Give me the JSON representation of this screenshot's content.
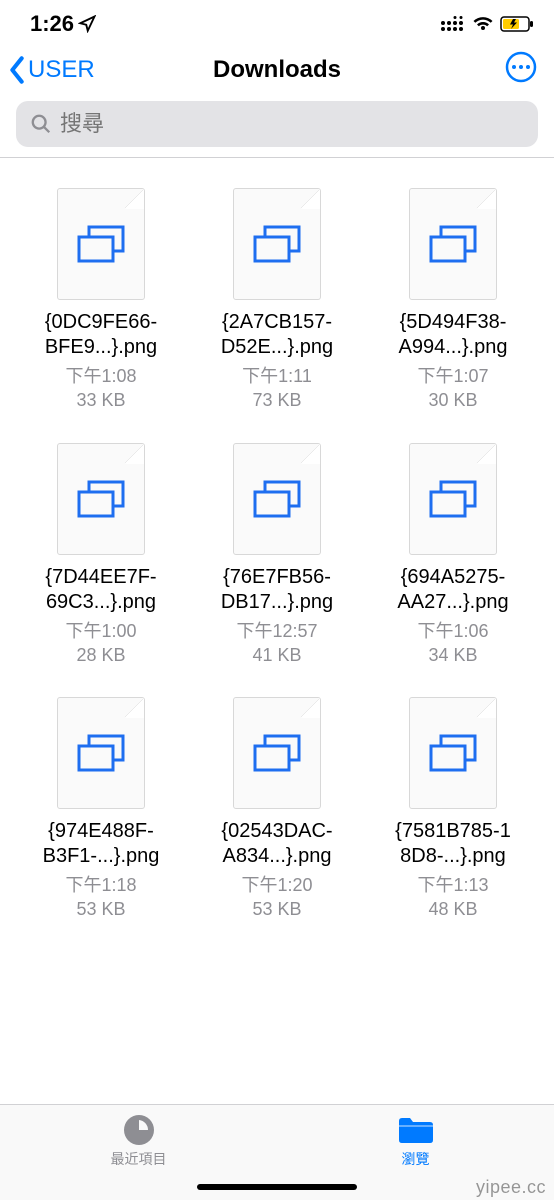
{
  "status": {
    "time": "1:26"
  },
  "nav": {
    "back_label": "USER",
    "title": "Downloads"
  },
  "search": {
    "placeholder": "搜尋"
  },
  "files": [
    {
      "name_l1": "{0DC9FE66-",
      "name_l2": "BFE9...}.png",
      "time": "下午1:08",
      "size": "33 KB"
    },
    {
      "name_l1": "{2A7CB157-",
      "name_l2": "D52E...}.png",
      "time": "下午1:11",
      "size": "73 KB"
    },
    {
      "name_l1": "{5D494F38-",
      "name_l2": "A994...}.png",
      "time": "下午1:07",
      "size": "30 KB"
    },
    {
      "name_l1": "{7D44EE7F-",
      "name_l2": "69C3...}.png",
      "time": "下午1:00",
      "size": "28 KB"
    },
    {
      "name_l1": "{76E7FB56-",
      "name_l2": "DB17...}.png",
      "time": "下午12:57",
      "size": "41 KB"
    },
    {
      "name_l1": "{694A5275-",
      "name_l2": "AA27...}.png",
      "time": "下午1:06",
      "size": "34 KB"
    },
    {
      "name_l1": "{974E488F-",
      "name_l2": "B3F1-...}.png",
      "time": "下午1:18",
      "size": "53 KB"
    },
    {
      "name_l1": "{02543DAC-",
      "name_l2": "A834...}.png",
      "time": "下午1:20",
      "size": "53 KB"
    },
    {
      "name_l1": "{7581B785-1",
      "name_l2": "8D8-...}.png",
      "time": "下午1:13",
      "size": "48 KB"
    }
  ],
  "tabs": {
    "recent": "最近項目",
    "browse": "瀏覽"
  },
  "watermark": "yipee.cc"
}
